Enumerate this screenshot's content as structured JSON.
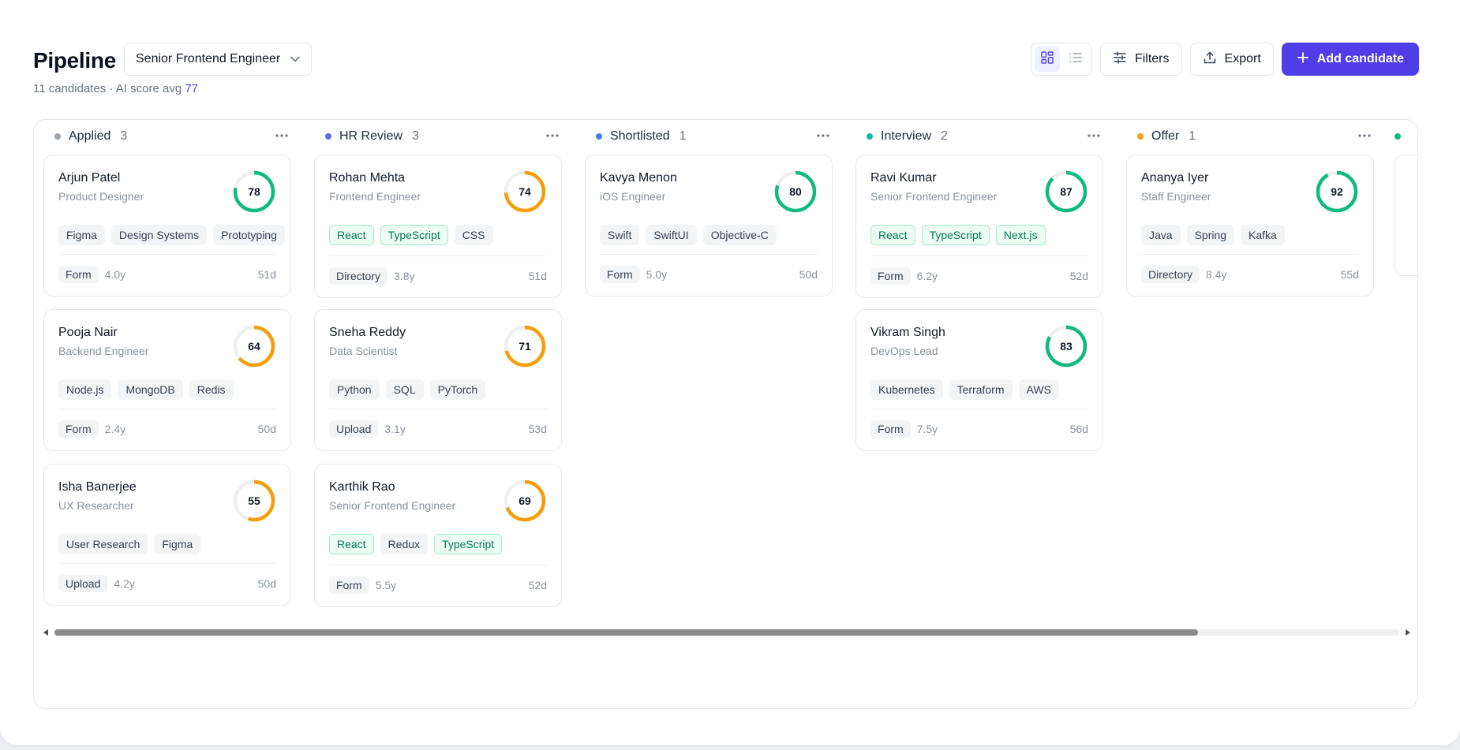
{
  "header": {
    "title": "Pipeline",
    "role_select": "Senior Frontend Engineer",
    "subtitle_prefix": "11 candidates · AI score avg ",
    "subtitle_avg": "77",
    "filters_label": "Filters",
    "export_label": "Export",
    "add_label": "Add candidate"
  },
  "colors": {
    "accent": "#4f3ee8",
    "score_high": "#10b981",
    "score_mid": "#f59e0b",
    "ring_track": "#eef0f2"
  },
  "icons": [
    "chevron-down-icon",
    "board-view-icon",
    "list-view-icon",
    "filters-icon",
    "export-icon",
    "plus-icon",
    "more-icon"
  ],
  "columns": [
    {
      "name": "Applied",
      "count": "3",
      "dot": "#9ca3af",
      "cards": [
        {
          "name": "Arjun Patel",
          "role": "Product Designer",
          "score": "78",
          "score_value": 78,
          "tags": [
            {
              "t": "Figma"
            },
            {
              "t": "Design Systems"
            },
            {
              "t": "Prototyping"
            }
          ],
          "source": "Form",
          "exp": "4.0y",
          "days": "51d"
        },
        {
          "name": "Pooja Nair",
          "role": "Backend Engineer",
          "score": "64",
          "score_value": 64,
          "tags": [
            {
              "t": "Node.js"
            },
            {
              "t": "MongoDB"
            },
            {
              "t": "Redis"
            }
          ],
          "source": "Form",
          "exp": "2.4y",
          "days": "50d"
        },
        {
          "name": "Isha Banerjee",
          "role": "UX Researcher",
          "score": "55",
          "score_value": 55,
          "tags": [
            {
              "t": "User Research"
            },
            {
              "t": "Figma"
            }
          ],
          "source": "Upload",
          "exp": "4.2y",
          "days": "50d"
        }
      ]
    },
    {
      "name": "HR Review",
      "count": "3",
      "dot": "#6366f1",
      "cards": [
        {
          "name": "Rohan Mehta",
          "role": "Frontend Engineer",
          "score": "74",
          "score_value": 74,
          "tags": [
            {
              "t": "React",
              "m": true
            },
            {
              "t": "TypeScript",
              "m": true
            },
            {
              "t": "CSS"
            }
          ],
          "source": "Directory",
          "exp": "3.8y",
          "days": "51d"
        },
        {
          "name": "Sneha Reddy",
          "role": "Data Scientist",
          "score": "71",
          "score_value": 71,
          "tags": [
            {
              "t": "Python"
            },
            {
              "t": "SQL"
            },
            {
              "t": "PyTorch"
            }
          ],
          "source": "Upload",
          "exp": "3.1y",
          "days": "53d"
        },
        {
          "name": "Karthik Rao",
          "role": "Senior Frontend Engineer",
          "score": "69",
          "score_value": 69,
          "tags": [
            {
              "t": "React",
              "m": true
            },
            {
              "t": "Redux"
            },
            {
              "t": "TypeScript",
              "m": true
            }
          ],
          "source": "Form",
          "exp": "5.5y",
          "days": "52d"
        }
      ]
    },
    {
      "name": "Shortlisted",
      "count": "1",
      "dot": "#3b82f6",
      "cards": [
        {
          "name": "Kavya Menon",
          "role": "iOS Engineer",
          "score": "80",
          "score_value": 80,
          "tags": [
            {
              "t": "Swift"
            },
            {
              "t": "SwiftUI"
            },
            {
              "t": "Objective-C"
            }
          ],
          "source": "Form",
          "exp": "5.0y",
          "days": "50d"
        }
      ]
    },
    {
      "name": "Interview",
      "count": "2",
      "dot": "#14b8a6",
      "cards": [
        {
          "name": "Ravi Kumar",
          "role": "Senior Frontend Engineer",
          "score": "87",
          "score_value": 87,
          "tags": [
            {
              "t": "React",
              "m": true
            },
            {
              "t": "TypeScript",
              "m": true
            },
            {
              "t": "Next.js",
              "m": true
            }
          ],
          "source": "Form",
          "exp": "6.2y",
          "days": "52d"
        },
        {
          "name": "Vikram Singh",
          "role": "DevOps Lead",
          "score": "83",
          "score_value": 83,
          "tags": [
            {
              "t": "Kubernetes"
            },
            {
              "t": "Terraform"
            },
            {
              "t": "AWS"
            }
          ],
          "source": "Form",
          "exp": "7.5y",
          "days": "56d"
        }
      ]
    },
    {
      "name": "Offer",
      "count": "1",
      "dot": "#f59e0b",
      "cards": [
        {
          "name": "Ananya Iyer",
          "role": "Staff Engineer",
          "score": "92",
          "score_value": 92,
          "tags": [
            {
              "t": "Java"
            },
            {
              "t": "Spring"
            },
            {
              "t": "Kafka"
            }
          ],
          "source": "Directory",
          "exp": "8.4y",
          "days": "55d"
        }
      ]
    }
  ]
}
